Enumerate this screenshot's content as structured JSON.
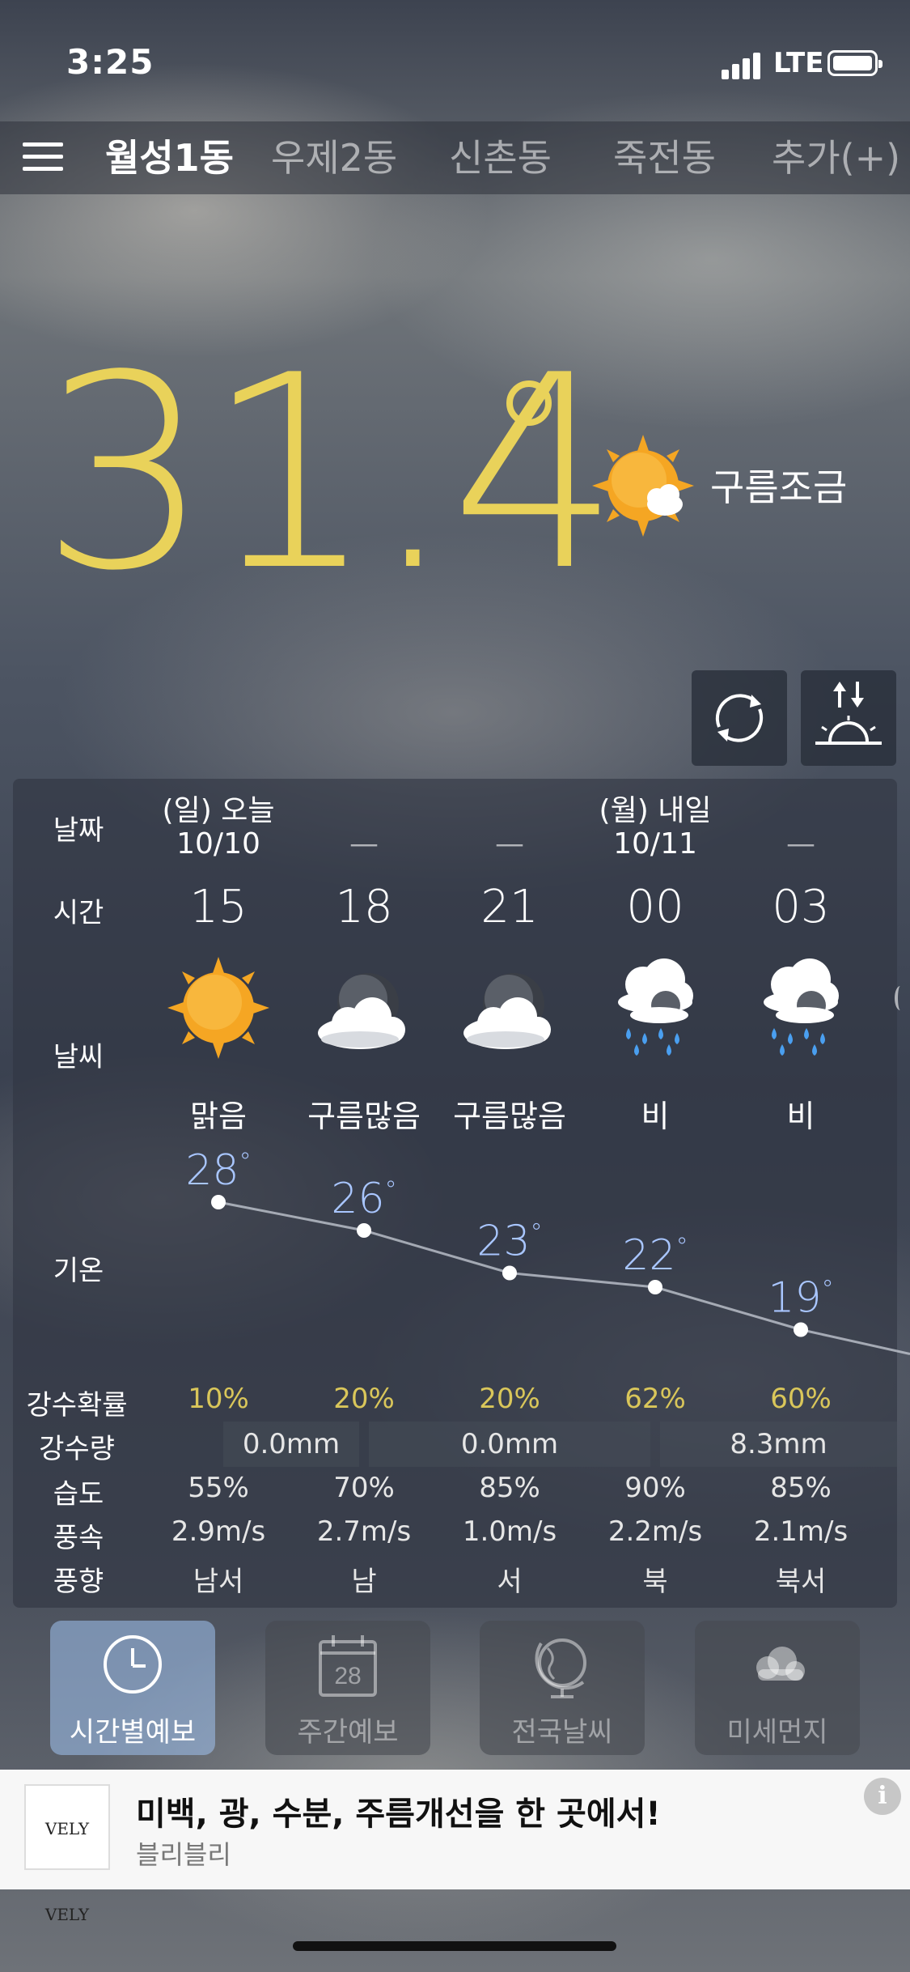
{
  "status": {
    "time": "3:25",
    "network": "LTE"
  },
  "tabs": [
    "월성1동",
    "우제2동",
    "신촌동",
    "죽전동",
    "추가(+)"
  ],
  "current": {
    "temperature": "31.4",
    "condition": "구름조금",
    "condition_icon": "sun-cloud-icon",
    "temp_color": "#e9d25a"
  },
  "forecast": {
    "labels": {
      "date": "날짜",
      "time": "시간",
      "weather": "날씨",
      "temp": "기온",
      "precip_prob": "강수확률",
      "precip_amt": "강수량",
      "humidity": "습도",
      "wind_speed": "풍속",
      "wind_dir": "풍향"
    },
    "columns": [
      {
        "day": "(일) 오늘",
        "date": "10/10",
        "time": "15",
        "icon": "sunny-icon",
        "desc": "맑음",
        "temp": "28",
        "prob": "10%",
        "humidity": "55%",
        "wind_speed": "2.9m/s",
        "wind_dir": "남서"
      },
      {
        "day": "",
        "date": "—",
        "time": "18",
        "icon": "cloudy-icon",
        "desc": "구름많음",
        "temp": "26",
        "prob": "20%",
        "humidity": "70%",
        "wind_speed": "2.7m/s",
        "wind_dir": "남"
      },
      {
        "day": "",
        "date": "—",
        "time": "21",
        "icon": "cloudy-icon",
        "desc": "구름많음",
        "temp": "23",
        "prob": "20%",
        "humidity": "85%",
        "wind_speed": "1.0m/s",
        "wind_dir": "서"
      },
      {
        "day": "(월) 내일",
        "date": "10/11",
        "time": "00",
        "icon": "rain-icon",
        "desc": "비",
        "temp": "22",
        "prob": "62%",
        "humidity": "90%",
        "wind_speed": "2.2m/s",
        "wind_dir": "북"
      },
      {
        "day": "",
        "date": "—",
        "time": "03",
        "icon": "rain-icon",
        "desc": "비",
        "temp": "19",
        "prob": "60%",
        "humidity": "85%",
        "wind_speed": "2.1m/s",
        "wind_dir": "북서"
      }
    ],
    "rain_amounts": [
      "0.0mm",
      "0.0mm",
      "8.3mm"
    ]
  },
  "nav": [
    {
      "label": "시간별예보",
      "icon": "clock-icon",
      "active": true
    },
    {
      "label": "주간예보",
      "icon": "calendar-icon",
      "calendar_day": "28",
      "active": false
    },
    {
      "label": "전국날씨",
      "icon": "globe-icon",
      "active": false
    },
    {
      "label": "미세먼지",
      "icon": "cloud-icon",
      "active": false
    }
  ],
  "ad": {
    "logo": "VELY VELY",
    "title": "미백, 광, 수분, 주름개선을 한 곳에서!",
    "subtitle": "블리블리",
    "info": "i"
  }
}
